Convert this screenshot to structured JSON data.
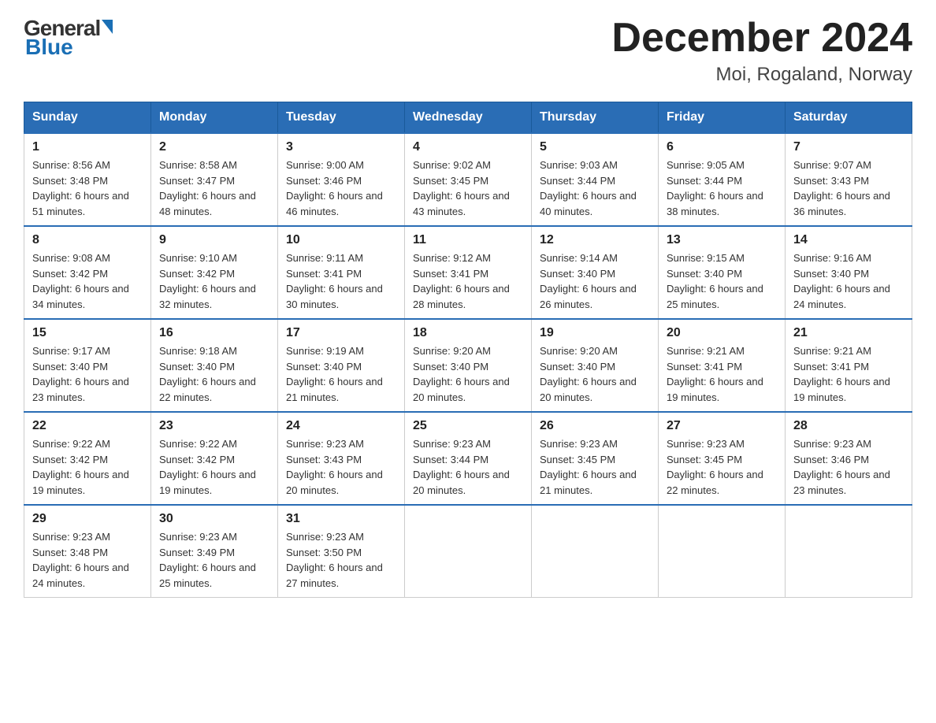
{
  "header": {
    "logo_text_general": "General",
    "logo_text_blue": "Blue",
    "title": "December 2024",
    "subtitle": "Moi, Rogaland, Norway"
  },
  "days_of_week": [
    "Sunday",
    "Monday",
    "Tuesday",
    "Wednesday",
    "Thursday",
    "Friday",
    "Saturday"
  ],
  "weeks": [
    [
      {
        "num": "1",
        "sunrise": "Sunrise: 8:56 AM",
        "sunset": "Sunset: 3:48 PM",
        "daylight": "Daylight: 6 hours and 51 minutes."
      },
      {
        "num": "2",
        "sunrise": "Sunrise: 8:58 AM",
        "sunset": "Sunset: 3:47 PM",
        "daylight": "Daylight: 6 hours and 48 minutes."
      },
      {
        "num": "3",
        "sunrise": "Sunrise: 9:00 AM",
        "sunset": "Sunset: 3:46 PM",
        "daylight": "Daylight: 6 hours and 46 minutes."
      },
      {
        "num": "4",
        "sunrise": "Sunrise: 9:02 AM",
        "sunset": "Sunset: 3:45 PM",
        "daylight": "Daylight: 6 hours and 43 minutes."
      },
      {
        "num": "5",
        "sunrise": "Sunrise: 9:03 AM",
        "sunset": "Sunset: 3:44 PM",
        "daylight": "Daylight: 6 hours and 40 minutes."
      },
      {
        "num": "6",
        "sunrise": "Sunrise: 9:05 AM",
        "sunset": "Sunset: 3:44 PM",
        "daylight": "Daylight: 6 hours and 38 minutes."
      },
      {
        "num": "7",
        "sunrise": "Sunrise: 9:07 AM",
        "sunset": "Sunset: 3:43 PM",
        "daylight": "Daylight: 6 hours and 36 minutes."
      }
    ],
    [
      {
        "num": "8",
        "sunrise": "Sunrise: 9:08 AM",
        "sunset": "Sunset: 3:42 PM",
        "daylight": "Daylight: 6 hours and 34 minutes."
      },
      {
        "num": "9",
        "sunrise": "Sunrise: 9:10 AM",
        "sunset": "Sunset: 3:42 PM",
        "daylight": "Daylight: 6 hours and 32 minutes."
      },
      {
        "num": "10",
        "sunrise": "Sunrise: 9:11 AM",
        "sunset": "Sunset: 3:41 PM",
        "daylight": "Daylight: 6 hours and 30 minutes."
      },
      {
        "num": "11",
        "sunrise": "Sunrise: 9:12 AM",
        "sunset": "Sunset: 3:41 PM",
        "daylight": "Daylight: 6 hours and 28 minutes."
      },
      {
        "num": "12",
        "sunrise": "Sunrise: 9:14 AM",
        "sunset": "Sunset: 3:40 PM",
        "daylight": "Daylight: 6 hours and 26 minutes."
      },
      {
        "num": "13",
        "sunrise": "Sunrise: 9:15 AM",
        "sunset": "Sunset: 3:40 PM",
        "daylight": "Daylight: 6 hours and 25 minutes."
      },
      {
        "num": "14",
        "sunrise": "Sunrise: 9:16 AM",
        "sunset": "Sunset: 3:40 PM",
        "daylight": "Daylight: 6 hours and 24 minutes."
      }
    ],
    [
      {
        "num": "15",
        "sunrise": "Sunrise: 9:17 AM",
        "sunset": "Sunset: 3:40 PM",
        "daylight": "Daylight: 6 hours and 23 minutes."
      },
      {
        "num": "16",
        "sunrise": "Sunrise: 9:18 AM",
        "sunset": "Sunset: 3:40 PM",
        "daylight": "Daylight: 6 hours and 22 minutes."
      },
      {
        "num": "17",
        "sunrise": "Sunrise: 9:19 AM",
        "sunset": "Sunset: 3:40 PM",
        "daylight": "Daylight: 6 hours and 21 minutes."
      },
      {
        "num": "18",
        "sunrise": "Sunrise: 9:20 AM",
        "sunset": "Sunset: 3:40 PM",
        "daylight": "Daylight: 6 hours and 20 minutes."
      },
      {
        "num": "19",
        "sunrise": "Sunrise: 9:20 AM",
        "sunset": "Sunset: 3:40 PM",
        "daylight": "Daylight: 6 hours and 20 minutes."
      },
      {
        "num": "20",
        "sunrise": "Sunrise: 9:21 AM",
        "sunset": "Sunset: 3:41 PM",
        "daylight": "Daylight: 6 hours and 19 minutes."
      },
      {
        "num": "21",
        "sunrise": "Sunrise: 9:21 AM",
        "sunset": "Sunset: 3:41 PM",
        "daylight": "Daylight: 6 hours and 19 minutes."
      }
    ],
    [
      {
        "num": "22",
        "sunrise": "Sunrise: 9:22 AM",
        "sunset": "Sunset: 3:42 PM",
        "daylight": "Daylight: 6 hours and 19 minutes."
      },
      {
        "num": "23",
        "sunrise": "Sunrise: 9:22 AM",
        "sunset": "Sunset: 3:42 PM",
        "daylight": "Daylight: 6 hours and 19 minutes."
      },
      {
        "num": "24",
        "sunrise": "Sunrise: 9:23 AM",
        "sunset": "Sunset: 3:43 PM",
        "daylight": "Daylight: 6 hours and 20 minutes."
      },
      {
        "num": "25",
        "sunrise": "Sunrise: 9:23 AM",
        "sunset": "Sunset: 3:44 PM",
        "daylight": "Daylight: 6 hours and 20 minutes."
      },
      {
        "num": "26",
        "sunrise": "Sunrise: 9:23 AM",
        "sunset": "Sunset: 3:45 PM",
        "daylight": "Daylight: 6 hours and 21 minutes."
      },
      {
        "num": "27",
        "sunrise": "Sunrise: 9:23 AM",
        "sunset": "Sunset: 3:45 PM",
        "daylight": "Daylight: 6 hours and 22 minutes."
      },
      {
        "num": "28",
        "sunrise": "Sunrise: 9:23 AM",
        "sunset": "Sunset: 3:46 PM",
        "daylight": "Daylight: 6 hours and 23 minutes."
      }
    ],
    [
      {
        "num": "29",
        "sunrise": "Sunrise: 9:23 AM",
        "sunset": "Sunset: 3:48 PM",
        "daylight": "Daylight: 6 hours and 24 minutes."
      },
      {
        "num": "30",
        "sunrise": "Sunrise: 9:23 AM",
        "sunset": "Sunset: 3:49 PM",
        "daylight": "Daylight: 6 hours and 25 minutes."
      },
      {
        "num": "31",
        "sunrise": "Sunrise: 9:23 AM",
        "sunset": "Sunset: 3:50 PM",
        "daylight": "Daylight: 6 hours and 27 minutes."
      },
      null,
      null,
      null,
      null
    ]
  ]
}
